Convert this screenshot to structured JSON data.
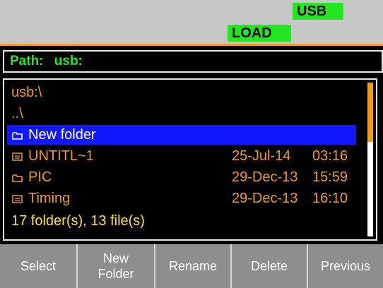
{
  "status": {
    "usb_label": "USB",
    "load_label": "LOAD"
  },
  "path_bar": {
    "label": "Path:",
    "value": "usb:"
  },
  "browser": {
    "current_dir": "usb:\\",
    "parent_entry": "..\\",
    "entries": [
      {
        "type": "folder",
        "name": "New folder",
        "date": "",
        "time": "",
        "selected": true
      },
      {
        "type": "file",
        "name": "UNTITL~1",
        "date": "25-Jul-14",
        "time": "03:16",
        "selected": false
      },
      {
        "type": "folder",
        "name": "PIC",
        "date": "29-Dec-13",
        "time": "15:59",
        "selected": false
      },
      {
        "type": "file",
        "name": "Timing",
        "date": "29-Dec-13",
        "time": "16:10",
        "selected": false
      }
    ],
    "summary": "17 folder(s), 13 file(s)",
    "scroll_position": 0.0
  },
  "softkeys": {
    "select": "Select",
    "new_folder_line1": "New",
    "new_folder_line2": "Folder",
    "rename": "Rename",
    "delete": "Delete",
    "previous": "Previous"
  },
  "colors": {
    "accent_orange": "#f39a1a",
    "status_green": "#22e61f",
    "selection_blue": "#1118ff",
    "summary_yellow": "#ffe51f"
  }
}
